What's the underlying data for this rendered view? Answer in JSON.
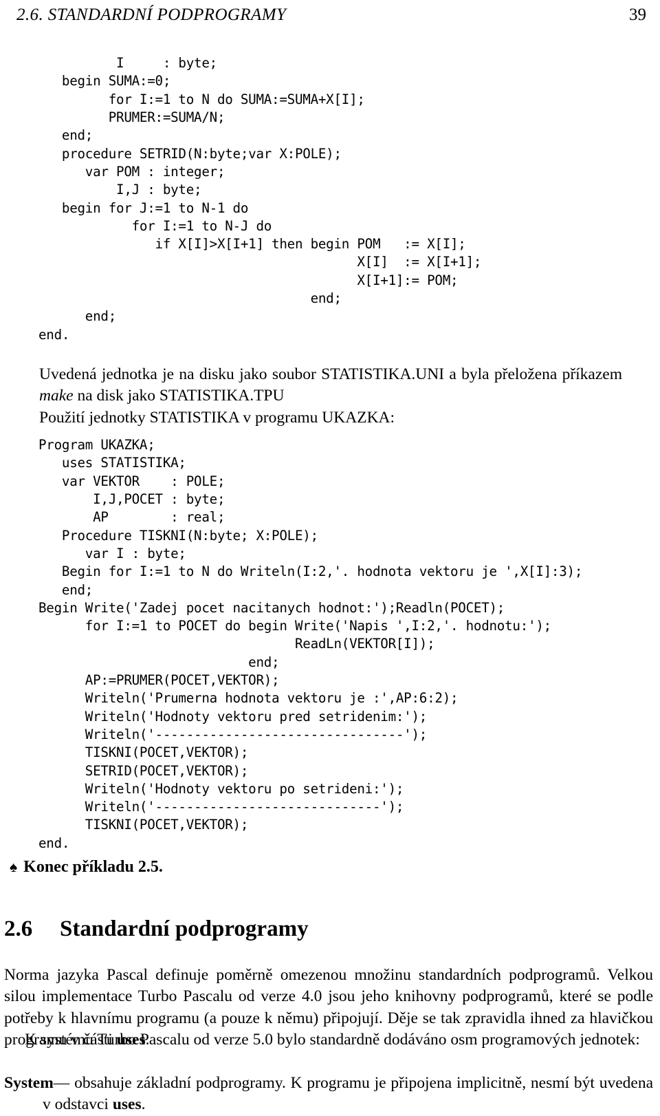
{
  "header": {
    "title": "2.6.  STANDARDNÍ PODPROGRAMY",
    "page_number": "39"
  },
  "code_block_1": "          I     : byte;\n   begin SUMA:=0;\n         for I:=1 to N do SUMA:=SUMA+X[I];\n         PRUMER:=SUMA/N;\n   end;\n   procedure SETRID(N:byte;var X:POLE);\n      var POM : integer;\n          I,J : byte;\n   begin for J:=1 to N-1 do\n            for I:=1 to N-J do\n               if X[I]>X[I+1] then begin POM   := X[I];\n                                         X[I]  := X[I+1];\n                                         X[I+1]:= POM;\n                                   end;\n      end;\nend.",
  "paragraph_unit": {
    "before_italic": "Uvedená jednotka je na disku jako soubor STATISTIKA.UNI a byla přeložena příkazem ",
    "italic": "make",
    "after_italic": " na disk jako STATISTIKA.TPU"
  },
  "paragraph_usage": "Použití jednotky STATISTIKA v programu UKAZKA:",
  "code_block_2": "Program UKAZKA;\n   uses STATISTIKA;\n   var VEKTOR    : POLE;\n       I,J,POCET : byte;\n       AP        : real;\n   Procedure TISKNI(N:byte; X:POLE);\n      var I : byte;\n   Begin for I:=1 to N do Writeln(I:2,'. hodnota vektoru je ',X[I]:3);\n   end;\nBegin Write('Zadej pocet nacitanych hodnot:');Readln(POCET);\n      for I:=1 to POCET do begin Write('Napis ',I:2,'. hodnotu:');\n                                 ReadLn(VEKTOR[I]);\n                           end;\n      AP:=PRUMER(POCET,VEKTOR);\n      Writeln('Prumerna hodnota vektoru je :',AP:6:2);\n      Writeln('Hodnoty vektoru pred setridenim:');\n      Writeln('--------------------------------');\n      TISKNI(POCET,VEKTOR);\n      SETRID(POCET,VEKTOR);\n      Writeln('Hodnoty vektoru po setrideni:');\n      Writeln('-----------------------------');\n      TISKNI(POCET,VEKTOR);\nend.",
  "example_end": {
    "symbol": "♠",
    "label": "Konec příkladu 2.5."
  },
  "section": {
    "number": "2.6",
    "title": "Standardní podprogramy"
  },
  "paragraph_norma": {
    "before_bold": "Norma jazyka Pascal definuje poměrně omezenou množinu standardních podprogramů. Velkou silou implementace Turbo Pascalu od verze 4.0 jsou jeho knihovny podprogramů, které se podle potřeby k hlavnímu programu (a pouze k němu) připojují. Děje se tak zpravidla ihned za hlavičkou programu v části ",
    "bold": "uses",
    "after_bold": "."
  },
  "paragraph_ksystemu": "K systému Turbo Pascalu od verze 5.0 bylo standardně dodáváno osm programových jednotek:",
  "paragraph_system": {
    "term": "System",
    "dash": "—",
    "text_before_bold": " obsahuje základní podprogramy. K programu je připojena implicitně, nesmí být uvedena v odstavci ",
    "bold": "uses",
    "text_after_bold": "."
  }
}
